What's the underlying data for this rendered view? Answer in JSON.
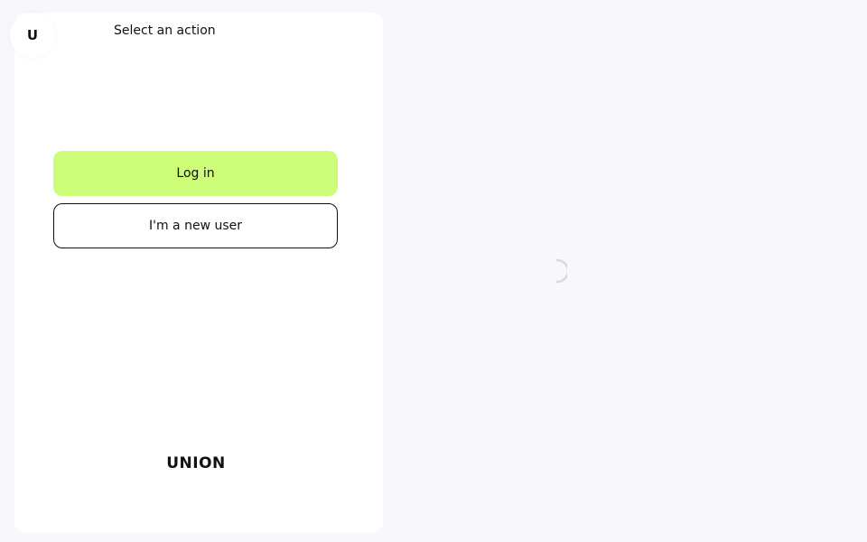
{
  "avatar": {
    "letter": "U"
  },
  "header": {
    "title": "Select an action"
  },
  "actions": {
    "login_label": "Log in",
    "new_user_label": "I'm a new user"
  },
  "brand": {
    "logo_text": "UNION"
  },
  "colors": {
    "accent": "#ccfc78",
    "background": "#f8f7fb",
    "panel": "#ffffff",
    "text": "#111111"
  },
  "icons": {
    "loading": "loading-spinner-icon"
  }
}
